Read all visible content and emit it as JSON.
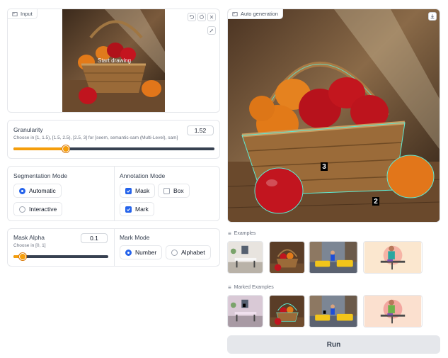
{
  "input": {
    "tag_label": "Input",
    "overlay_text": "Start drawing"
  },
  "granularity": {
    "label": "Granularity",
    "hint": "Choose in [1, 1.5), [1.5, 2.5), [2.5, 3] for [seem, semantic-sam (Multi-Level), sam]",
    "value": "1.52",
    "fraction": 0.26
  },
  "segmentation_mode": {
    "label": "Segmentation Mode",
    "options": [
      "Automatic",
      "Interactive"
    ],
    "selected": "Automatic"
  },
  "annotation_mode": {
    "label": "Annotation Mode",
    "options": [
      {
        "label": "Mask",
        "checked": true
      },
      {
        "label": "Box",
        "checked": false
      },
      {
        "label": "Mark",
        "checked": true
      }
    ]
  },
  "mask_alpha": {
    "label": "Mask Alpha",
    "hint": "Choose in [0, 1]",
    "value": "0.1",
    "fraction": 0.1
  },
  "mark_mode": {
    "label": "Mark Mode",
    "options": [
      "Number",
      "Alphabet"
    ],
    "selected": "Number"
  },
  "output": {
    "tag_label": "Auto generation",
    "marks": [
      "3",
      "2"
    ]
  },
  "examples": {
    "label": "Examples",
    "items": [
      "dining-room",
      "apple-basket",
      "taxi-street",
      "ironing-person"
    ]
  },
  "marked_examples": {
    "label": "Marked Examples",
    "items": [
      "dining-room-marked",
      "apple-basket-marked",
      "taxi-street-marked",
      "ironing-person-marked"
    ]
  },
  "run_button": {
    "label": "Run"
  },
  "colors": {
    "accent": "#2563eb",
    "slider": "#f59e0b",
    "mask_outline": "#5eead4"
  }
}
